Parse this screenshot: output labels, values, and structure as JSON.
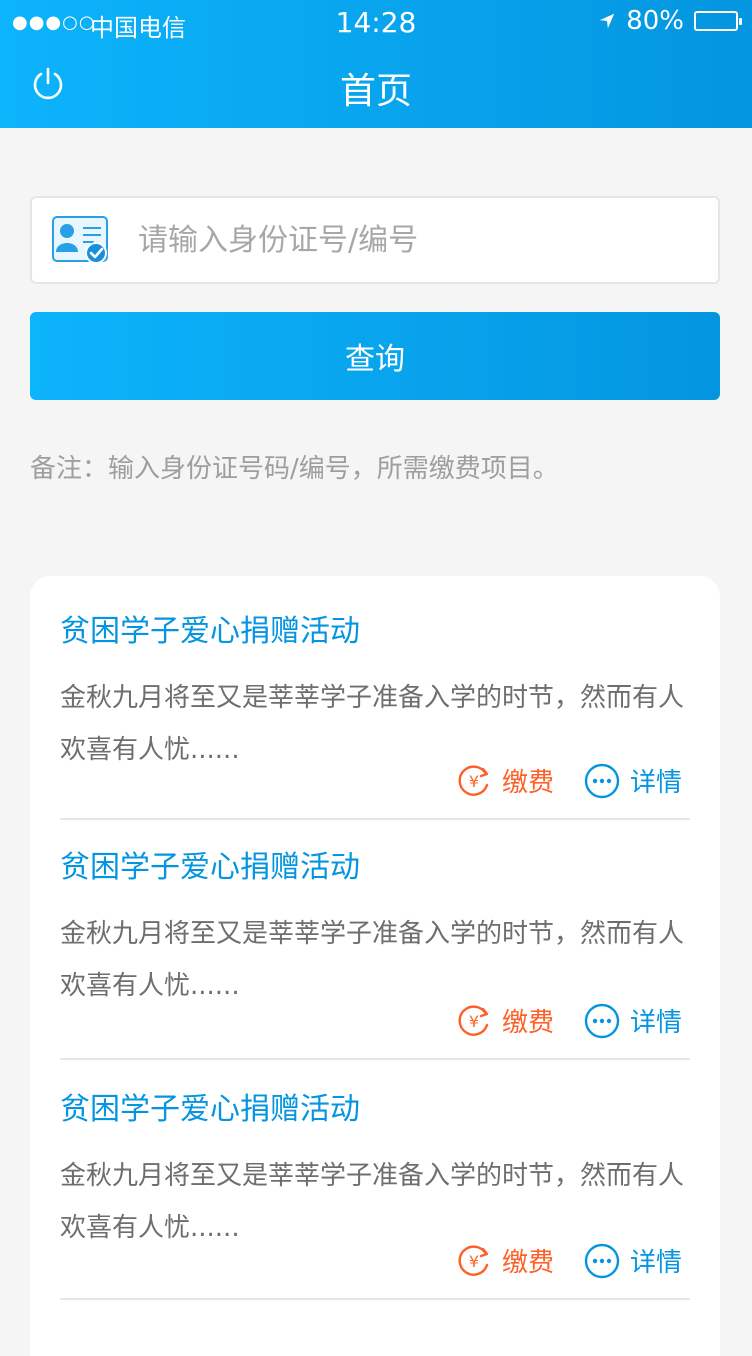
{
  "status_bar": {
    "signal": "●●●○○",
    "carrier": "中国电信",
    "time": "14:28",
    "battery": "80%"
  },
  "header": {
    "title": "首页",
    "gradient_start": "#0cb4fb",
    "gradient_end": "#0495e0",
    "icon": "power-icon"
  },
  "search": {
    "placeholder": "请输入身份证号/编号",
    "value": "",
    "icon": "id-card-icon"
  },
  "query_button": {
    "label": "查询"
  },
  "note": "备注：输入身份证号码/编号，所需缴费项目。",
  "cards": [
    {
      "title": "贫困学子爱心捐赠活动",
      "desc": "金秋九月将至又是莘莘学子准备入学的时节，然而有人欢喜有人忧......",
      "pay_label": "缴费",
      "detail_label": "详情"
    },
    {
      "title": "贫困学子爱心捐赠活动",
      "desc": "金秋九月将至又是莘莘学子准备入学的时节，然而有人欢喜有人忧......",
      "pay_label": "缴费",
      "detail_label": "详情"
    },
    {
      "title": "贫困学子爱心捐赠活动",
      "desc": "金秋九月将至又是莘莘学子准备入学的时节，然而有人欢喜有人忧......",
      "pay_label": "缴费",
      "detail_label": "详情"
    }
  ],
  "colors": {
    "title_blue": "#0495e0",
    "desc_gray": "#6e6e6e",
    "pay_orange": "#ff5f27",
    "border": "#e6e6e6",
    "placeholder": "#9e9e9e"
  }
}
